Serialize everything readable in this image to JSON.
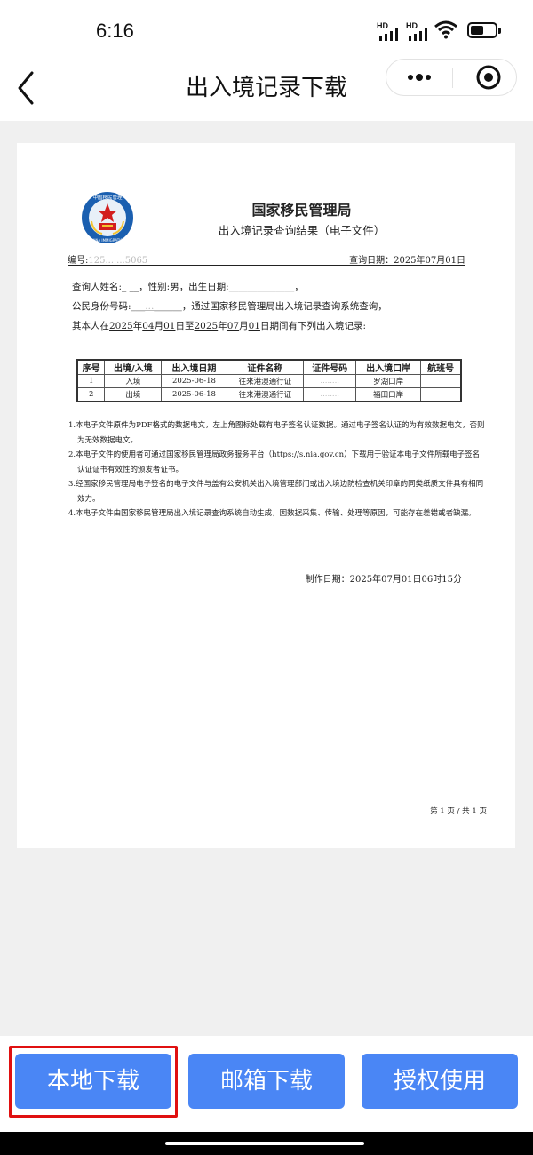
{
  "status_bar": {
    "time": "6:16",
    "signal_label_1": "HD",
    "signal_label_2": "HD",
    "icons": [
      "signal-icon",
      "signal-icon",
      "wifi-icon",
      "battery-icon"
    ]
  },
  "nav": {
    "title": "出入境记录下载",
    "icons": [
      "back-arrow-icon",
      "more-dots-icon",
      "close-target-icon"
    ]
  },
  "document": {
    "agency": "国家移民管理局",
    "emblem_text_cn": "中国移民管理",
    "emblem_text_en": "CHINA IMMIGRATION",
    "subtitle": "出入境记录查询结果（电子文件）",
    "serial_label": "编号:",
    "serial_value": "125... ...5065",
    "query_date": "查询日期：2025年07月01日",
    "line1": {
      "name_label": "查询人姓名:",
      "name_value": "_  __",
      "gender_label": "，性别:",
      "gender_value": "男",
      "birth_label": "，出生日期:",
      "birth_value": "______________",
      "tail": "，"
    },
    "line2": {
      "id_label": "公民身份号码:",
      "id_value": "___...______",
      "tail": "，通过国家移民管理局出入境记录查询系统查询，"
    },
    "line3": {
      "p1": "其本人在",
      "y1": "2025",
      "p2": "年",
      "m1": "04",
      "p3": "月",
      "d1": "01",
      "p4": "日至",
      "y2": "2025",
      "p5": "年",
      "m2": "07",
      "p6": "月",
      "d2": "01",
      "p7": "日期间有下列出入境记录:"
    },
    "table": {
      "headers": [
        "序号",
        "出境/入境",
        "出入境日期",
        "证件名称",
        "证件号码",
        "出入境口岸",
        "航班号"
      ],
      "rows": [
        [
          "1",
          "入境",
          "2025-06-18",
          "往来港澳通行证",
          "........",
          "罗湖口岸",
          ""
        ],
        [
          "2",
          "出境",
          "2025-06-18",
          "往来港澳通行证",
          "........",
          "福田口岸",
          ""
        ]
      ]
    },
    "notes": [
      "1.本电子文件原件为PDF格式的数据电文，左上角图标处载有电子签名认证数据。通过电子签名认证的为有效数据电文，否则为无效数据电文。",
      "2.本电子文件的使用者可通过国家移民管理局政务服务平台（https://s.nia.gov.cn）下载用于验证本电子文件所载电子签名认证证书有效性的颁发者证书。",
      "3.经国家移民管理局电子签名的电子文件与盖有公安机关出入境管理部门或出入境边防检查机关印章的同类纸质文件具有相同效力。",
      "4.本电子文件由国家移民管理局出入境记录查询系统自动生成，因数据采集、传输、处理等原因，可能存在差错或者缺漏。"
    ],
    "made_date": "制作日期：2025年07月01日06时15分",
    "page_number": "第 1 页 / 共 1 页"
  },
  "buttons": {
    "local_download": "本地下载",
    "email_download": "邮箱下载",
    "authorize_use": "授权使用"
  },
  "colors": {
    "button_blue": "#4a86f5",
    "highlight_red": "#e01010",
    "viewer_bg": "#f0f0f0"
  }
}
